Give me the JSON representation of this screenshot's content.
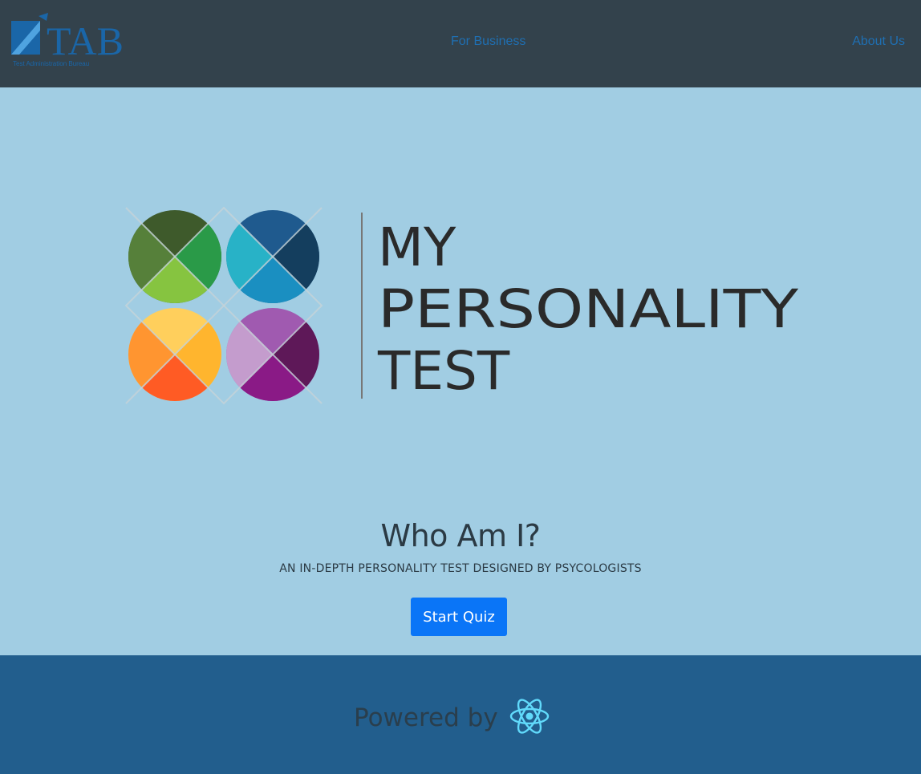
{
  "header": {
    "logo_text": "TAB",
    "logo_tagline": "Test Administration Bureau",
    "nav": {
      "business_label": "For Business",
      "about_label": "About Us"
    }
  },
  "hero": {
    "logo_line1": "MY",
    "logo_line2": "PERSONALITY",
    "logo_line3": "TEST",
    "title": "Who Am I?",
    "subtitle": "AN IN-DEPTH PERSONALITY TEST DESIGNED BY PSYCOLOGISTS",
    "start_button_label": "Start Quiz"
  },
  "footer": {
    "powered_label": "Powered by",
    "icon": "react-icon"
  },
  "colors": {
    "navbar_bg": "#33424c",
    "nav_link": "#1f6fb2",
    "hero_bg": "#a1cde3",
    "button_bg": "#0a75f7",
    "footer_bg": "#225e8d",
    "react_cyan": "#61dafb"
  }
}
